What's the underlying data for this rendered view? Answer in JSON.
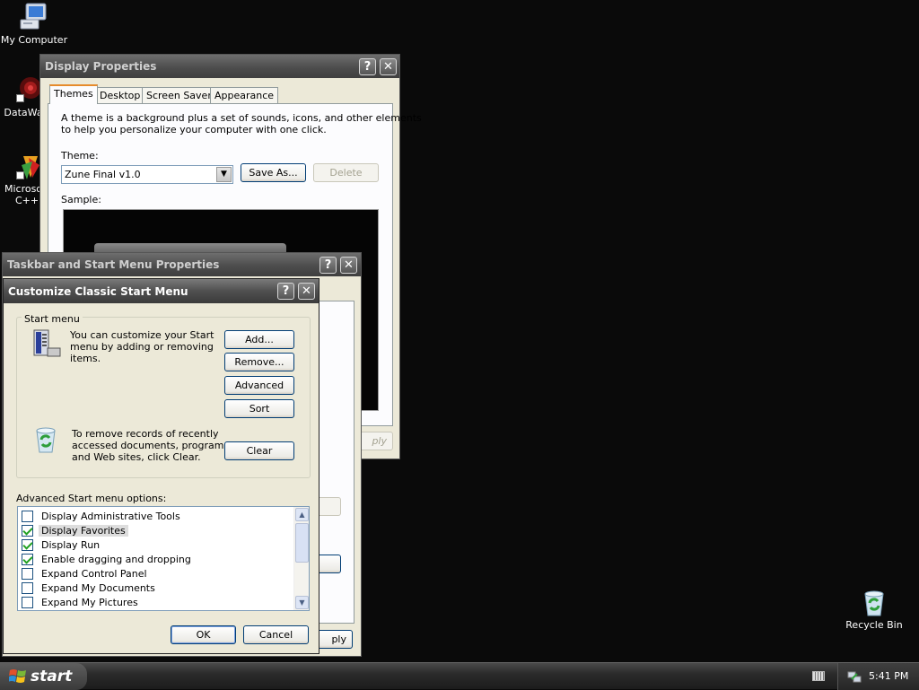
{
  "desktop": {
    "icons": [
      {
        "name": "my-computer",
        "label": "My Computer"
      },
      {
        "name": "datawatch",
        "label": "DataWa"
      },
      {
        "name": "ms-cpp",
        "label": "Microsoft\nC++"
      },
      {
        "name": "recycle-bin",
        "label": "Recycle Bin"
      }
    ]
  },
  "display_props": {
    "title": "Display Properties",
    "tabs": [
      "Themes",
      "Desktop",
      "Screen Saver",
      "Appearance"
    ],
    "active_tab": "Themes",
    "description_line1": "A theme is a background plus a set of sounds, icons, and other elements",
    "description_line2": "to help you personalize your computer with one click.",
    "theme_label": "Theme:",
    "theme_value": "Zune Final v1.0",
    "save_as_label": "Save As...",
    "delete_label": "Delete",
    "sample_label": "Sample:",
    "apply_partial": "ply"
  },
  "taskbar_props": {
    "title": "Taskbar and Start Menu Properties",
    "apply_partial": "ply"
  },
  "customize": {
    "title": "Customize Classic Start Menu",
    "group_label": "Start menu",
    "customize_text_l1": "You can customize your Start",
    "customize_text_l2": "menu by adding or removing",
    "customize_text_l3": "items.",
    "add_label": "Add...",
    "remove_label": "Remove...",
    "advanced_label": "Advanced",
    "sort_label": "Sort",
    "clear_text_l1": "To remove records of recently",
    "clear_text_l2": "accessed documents, programs,",
    "clear_text_l3": "and Web sites, click Clear.",
    "clear_label": "Clear",
    "options_label": "Advanced Start menu options:",
    "options": [
      {
        "label": "Display Administrative Tools",
        "checked": false
      },
      {
        "label": "Display Favorites",
        "checked": true
      },
      {
        "label": "Display Run",
        "checked": true
      },
      {
        "label": "Enable dragging and dropping",
        "checked": true
      },
      {
        "label": "Expand Control Panel",
        "checked": false
      },
      {
        "label": "Expand My Documents",
        "checked": false
      },
      {
        "label": "Expand My Pictures",
        "checked": false
      }
    ],
    "selected_option_index": 1,
    "ok_label": "OK",
    "cancel_label": "Cancel"
  },
  "taskbar": {
    "start_label": "start",
    "clock": "5:41 PM"
  },
  "colors": {
    "desktop_bg": "#0a0a0a",
    "dialog_face": "#ece9d8",
    "tab_accent": "#e68b2c",
    "button_border": "#003c74"
  }
}
